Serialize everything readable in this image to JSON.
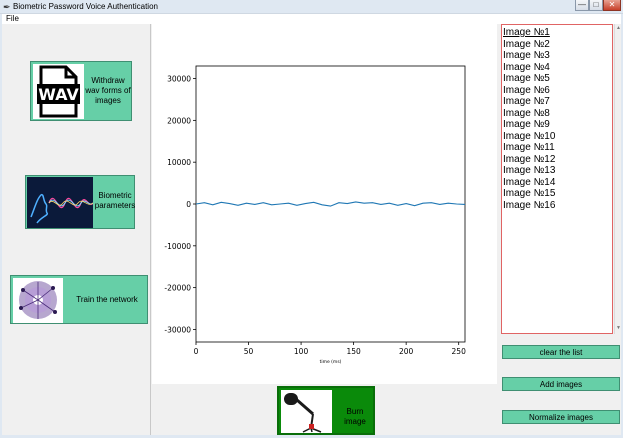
{
  "window": {
    "title": "Biometric Password Voice Authentication",
    "min_glyph": "—",
    "max_glyph": "□",
    "close_glyph": "✕"
  },
  "menu": {
    "file": "File"
  },
  "left_buttons": {
    "withdraw": {
      "label": "Withdraw wav forms of images",
      "thumb_text": "WAV",
      "icon": "wav-file-icon"
    },
    "biometric": {
      "label": "Biometric parameters",
      "icon": "voice-wave-icon"
    },
    "train": {
      "label": "Train the network",
      "icon": "neural-network-icon"
    }
  },
  "burn_button": {
    "label": "Burn image",
    "icon": "microphone-icon"
  },
  "image_list": {
    "items": [
      "Image №1",
      "Image №2",
      "Image №3",
      "Image №4",
      "Image №5",
      "Image №6",
      "Image №7",
      "Image №8",
      "Image №9",
      "Image №10",
      "Image №11",
      "Image №12",
      "Image №13",
      "Image №14",
      "Image №15",
      "Image №16"
    ],
    "selected": "Image №1",
    "border_color": "#e06464"
  },
  "side_buttons": {
    "clear": "clear the list",
    "add": "Add images",
    "normalize": "Normalize images"
  },
  "colors": {
    "button_green": "#66cfa7",
    "burn_green": "#0a8a0a",
    "line_blue": "#1f77b4"
  },
  "chart_data": {
    "type": "line",
    "title": "",
    "xlabel": "time (ms)",
    "ylabel": "",
    "xlim": [
      0,
      256
    ],
    "ylim": [
      -33000,
      33000
    ],
    "xticks": [
      0,
      50,
      100,
      150,
      200,
      250
    ],
    "yticks": [
      -30000,
      -20000,
      -10000,
      0,
      10000,
      20000,
      30000
    ],
    "grid": false,
    "series": [
      {
        "color": "#1f77b4",
        "x": [
          0,
          8,
          16,
          24,
          32,
          40,
          48,
          56,
          64,
          72,
          80,
          88,
          96,
          104,
          112,
          120,
          128,
          136,
          144,
          152,
          160,
          168,
          176,
          184,
          192,
          200,
          208,
          216,
          224,
          232,
          240,
          248,
          256
        ],
        "y": [
          0,
          300,
          -200,
          400,
          100,
          -300,
          200,
          -100,
          300,
          -200,
          0,
          200,
          -300,
          100,
          400,
          -200,
          -500,
          300,
          100,
          500,
          200,
          300,
          -100,
          200,
          -300,
          100,
          -400,
          200,
          300,
          -100,
          200,
          0,
          -100
        ]
      }
    ]
  }
}
